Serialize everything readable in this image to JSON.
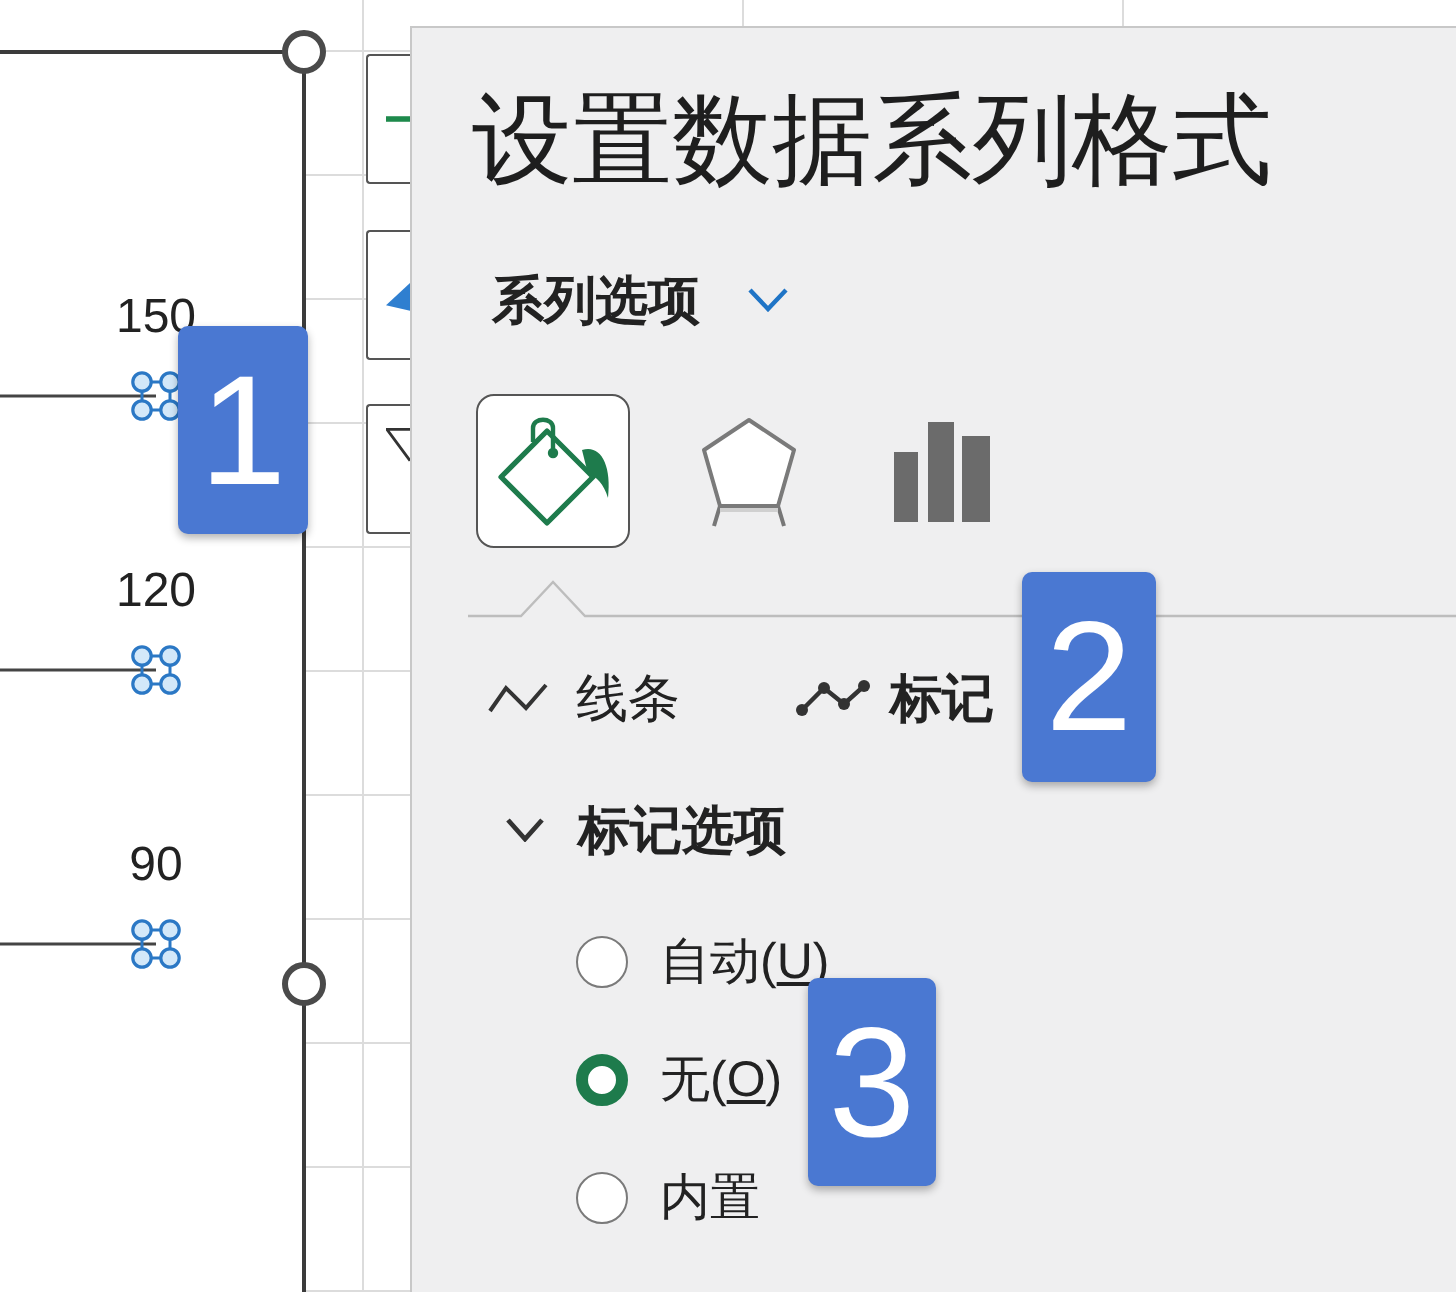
{
  "chart": {
    "selected": true,
    "points": [
      {
        "label": "150"
      },
      {
        "label": "120"
      },
      {
        "label": "90"
      }
    ]
  },
  "chart_buttons": [
    {
      "kind": "elements"
    },
    {
      "kind": "styles"
    },
    {
      "kind": "filters"
    }
  ],
  "panel": {
    "title": "设置数据系列格式",
    "section_menu": {
      "label": "系列选项"
    },
    "icon_tabs": [
      {
        "kind": "fill",
        "selected": true
      },
      {
        "kind": "effects",
        "selected": false
      },
      {
        "kind": "series",
        "selected": false
      }
    ],
    "subtabs": [
      {
        "kind": "line",
        "label": "线条",
        "selected": false
      },
      {
        "kind": "marker",
        "label": "标记",
        "selected": true
      }
    ],
    "marker_options": {
      "label": "标记选项",
      "expanded": true,
      "options": [
        {
          "text": "自动(",
          "key": "U",
          "end": ")",
          "selected": false
        },
        {
          "text": "无(",
          "key": "O",
          "end": ")",
          "selected": true
        },
        {
          "text": "内置",
          "selected": false
        }
      ]
    }
  },
  "callouts": [
    {
      "label": "1"
    },
    {
      "label": "2"
    },
    {
      "label": "3"
    }
  ]
}
